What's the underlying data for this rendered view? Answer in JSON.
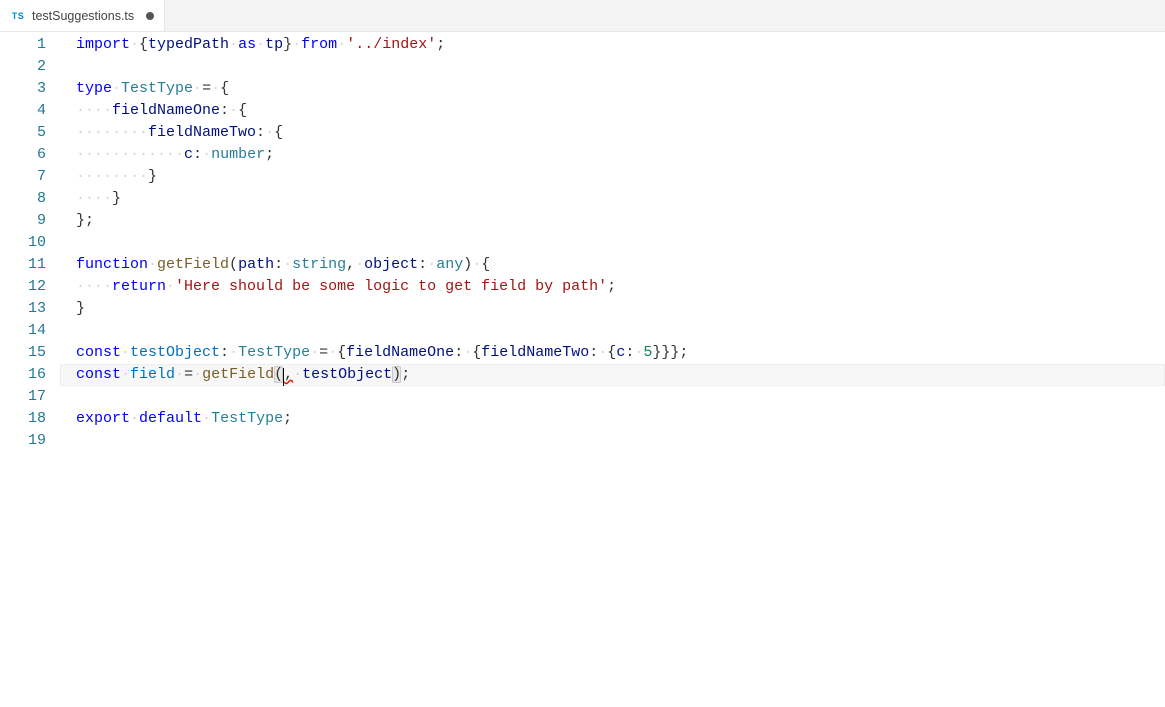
{
  "tab": {
    "icon": "TS",
    "filename": "testSuggestions.ts",
    "dirty": true
  },
  "gutter": {
    "lines": [
      "1",
      "2",
      "3",
      "4",
      "5",
      "6",
      "7",
      "8",
      "9",
      "10",
      "11",
      "12",
      "13",
      "14",
      "15",
      "16",
      "17",
      "18",
      "19"
    ]
  },
  "code": {
    "l1": {
      "import": "import",
      "as": "as",
      "from": "from",
      "typedPath": "typedPath",
      "tp": "tp",
      "path": "'../index'"
    },
    "l3": {
      "type": "type",
      "name": "TestType"
    },
    "l4": {
      "field": "fieldNameOne"
    },
    "l5": {
      "field": "fieldNameTwo"
    },
    "l6": {
      "field": "c",
      "typ": "number"
    },
    "l11": {
      "function": "function",
      "name": "getField",
      "p1": "path",
      "t1": "string",
      "p2": "object",
      "t2": "any"
    },
    "l12": {
      "return": "return",
      "str": "'Here should be some logic to get field by path'"
    },
    "l15": {
      "const": "const",
      "name": "testObject",
      "type": "TestType",
      "f1": "fieldNameOne",
      "f2": "fieldNameTwo",
      "f3": "c",
      "val": "5"
    },
    "l16": {
      "const": "const",
      "name": "field",
      "call": "getField",
      "arg": "testObject"
    },
    "l18": {
      "export": "export",
      "default": "default",
      "name": "TestType"
    }
  }
}
